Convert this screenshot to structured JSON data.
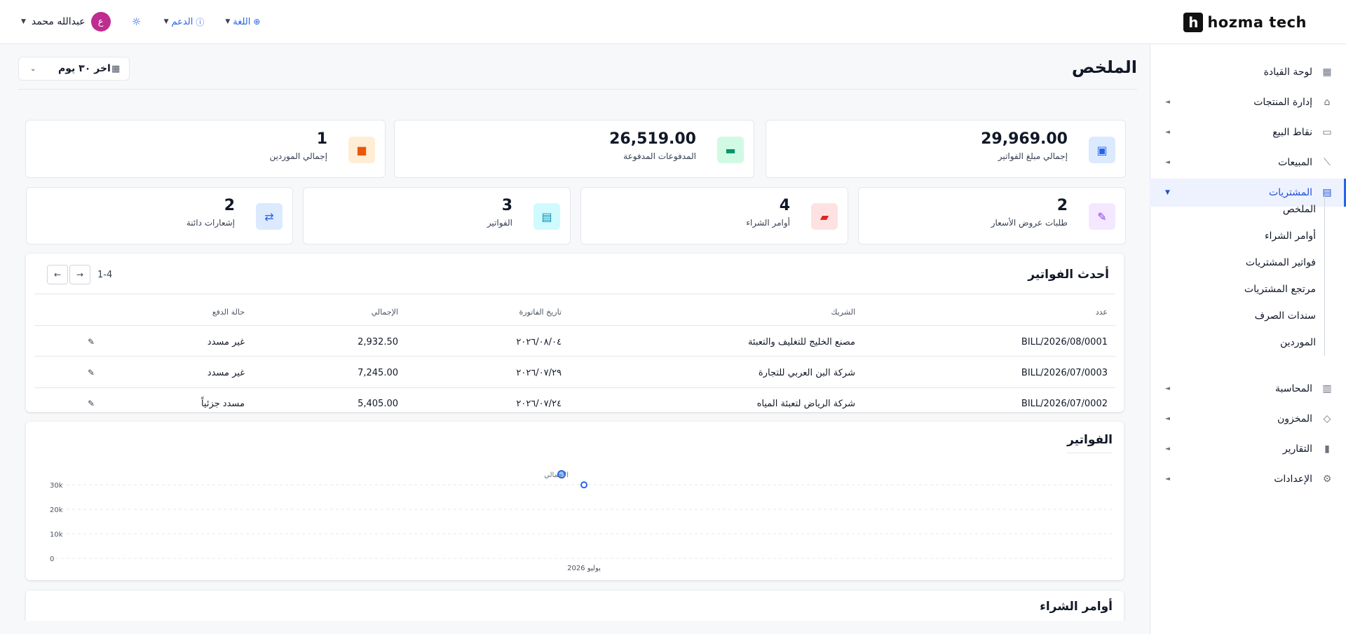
{
  "brand": {
    "logo_letter": "h",
    "name": "hozma tech"
  },
  "header": {
    "user_name": "عبدالله محمد",
    "avatar_initial": "ع",
    "support_label": "الدعم",
    "language_label": "اللغة",
    "theme_icon": "sun-icon"
  },
  "sidebar": {
    "items": [
      {
        "label": "لوحة القيادة",
        "icon": "dashboard-icon",
        "caret": ""
      },
      {
        "label": "إدارة المنتجات",
        "icon": "tag-icon",
        "caret": "◄"
      },
      {
        "label": "نقاط البيع",
        "icon": "store-icon",
        "caret": "◄"
      },
      {
        "label": "المبيعات",
        "icon": "chart-line-icon",
        "caret": "◄"
      },
      {
        "label": "المشتريات",
        "icon": "purchases-icon",
        "caret": "▼"
      },
      {
        "label": "المحاسبة",
        "icon": "accounting-icon",
        "caret": "◄"
      },
      {
        "label": "المخزون",
        "icon": "box-icon",
        "caret": "◄"
      },
      {
        "label": "التقارير",
        "icon": "reports-icon",
        "caret": "◄"
      },
      {
        "label": "الإعدادات",
        "icon": "gear-icon",
        "caret": "◄"
      }
    ],
    "sub_items": [
      "الملخص",
      "أوامر الشراء",
      "فواتير المشتريات",
      "مرتجع المشتريات",
      "سندات الصرف",
      "الموردين"
    ]
  },
  "page": {
    "title": "الملخص",
    "date_filter": "اخر ٣٠ يوم"
  },
  "stats_top": [
    {
      "value": "29,969.00",
      "label": "إجمالي مبلغ الفواتير",
      "icon": "money-icon",
      "color": "#2563eb",
      "bg": "#dbeafe"
    },
    {
      "value": "26,519.00",
      "label": "المدفوعات المدفوعة",
      "icon": "credit-card-icon",
      "color": "#059669",
      "bg": "#d1fae5"
    },
    {
      "value": "1",
      "label": "إجمالي الموردين",
      "icon": "truck-icon",
      "color": "#ea580c",
      "bg": "#ffedd5"
    }
  ],
  "stats_bottom": [
    {
      "value": "2",
      "label": "طلبات عروض الأسعار",
      "icon": "edit-icon",
      "color": "#9333ea",
      "bg": "#f3e8ff"
    },
    {
      "value": "4",
      "label": "أوامر الشراء",
      "icon": "cart-icon",
      "color": "#dc2626",
      "bg": "#fee2e2"
    },
    {
      "value": "3",
      "label": "الفواتير",
      "icon": "document-icon",
      "color": "#0891b2",
      "bg": "#cffafe"
    },
    {
      "value": "2",
      "label": "إشعارات دائنة",
      "icon": "exchange-icon",
      "color": "#2563eb",
      "bg": "#dbeafe"
    }
  ],
  "invoices_table": {
    "title": "أحدث الفواتير",
    "pagination": "1-4",
    "columns": [
      "عدد",
      "الشريك",
      "تاريخ الفاتورة",
      "الإجمالي",
      "حالة الدفع"
    ],
    "rows": [
      {
        "number": "BILL/2026/08/0001",
        "partner": "مصنع الخليج للتغليف والتعبئة",
        "date": "٢٠٢٦/٠٨/٠٤",
        "total": "2,932.50",
        "status": "غير مسدد"
      },
      {
        "number": "BILL/2026/07/0003",
        "partner": "شركة البن العربي للتجارة",
        "date": "٢٠٢٦/٠٧/٢٩",
        "total": "7,245.00",
        "status": "غير مسدد"
      },
      {
        "number": "BILL/2026/07/0002",
        "partner": "شركة الرياض لتعبئة المياه",
        "date": "٢٠٢٦/٠٧/٢٤",
        "total": "5,405.00",
        "status": "مسدد جزئياً"
      }
    ]
  },
  "chart_section": {
    "title": "الفواتير"
  },
  "chart_data": {
    "type": "line",
    "x": [
      "يوليو 2026"
    ],
    "series": [
      {
        "name": "الإجمالي",
        "values": [
          29969
        ]
      }
    ],
    "y_ticks": [
      "0",
      "10k",
      "20k",
      "30k"
    ],
    "ylim": [
      0,
      30000
    ],
    "legend": "top-center",
    "grid": true,
    "color": "#2563eb"
  },
  "orders_section": {
    "title": "أوامر الشراء"
  }
}
